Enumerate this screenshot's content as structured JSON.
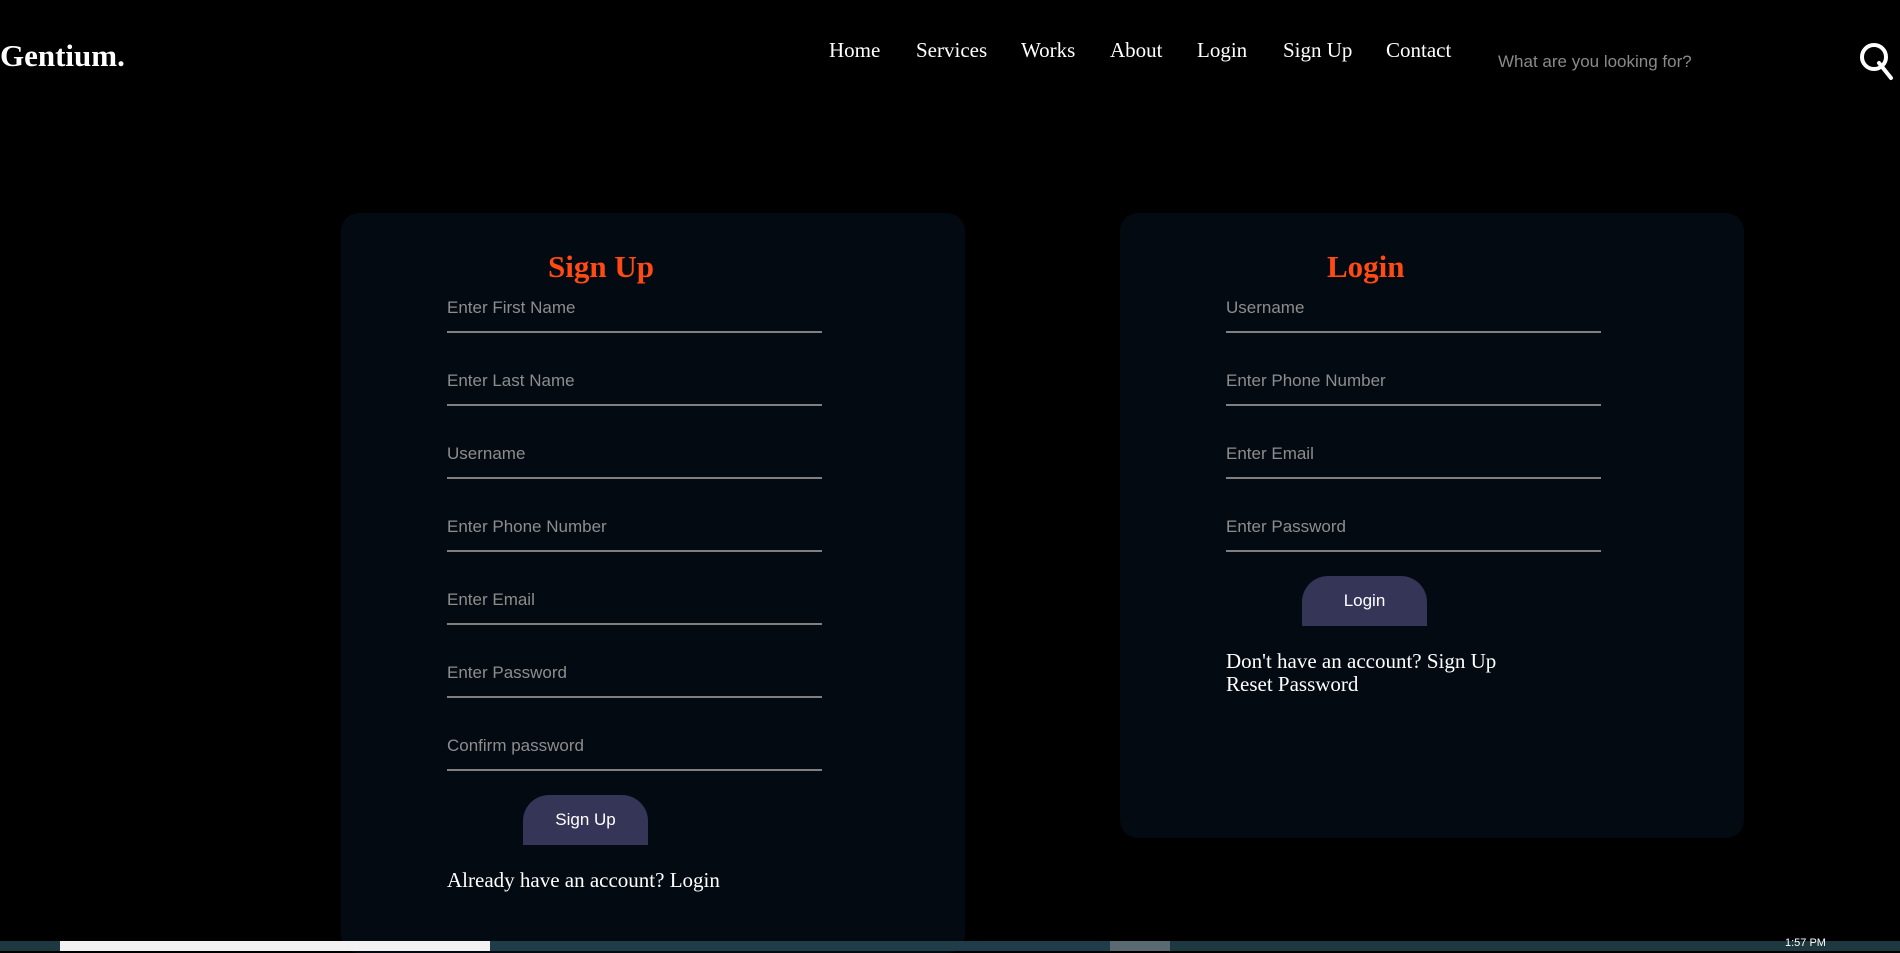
{
  "site": {
    "logo": "Gentium."
  },
  "nav": {
    "items": [
      {
        "id": "home",
        "label": "Home"
      },
      {
        "id": "services",
        "label": "Services"
      },
      {
        "id": "works",
        "label": "Works"
      },
      {
        "id": "about",
        "label": "About"
      },
      {
        "id": "login",
        "label": "Login"
      },
      {
        "id": "signup",
        "label": "Sign Up"
      },
      {
        "id": "contact",
        "label": "Contact"
      }
    ]
  },
  "search": {
    "placeholder": "What are you looking for?",
    "icon": "search-icon"
  },
  "signup_form": {
    "title": "Sign Up",
    "fields": {
      "first_name": "Enter First Name",
      "last_name": "Enter Last Name",
      "username": "Username",
      "phone": "Enter Phone Number",
      "email": "Enter Email",
      "password": "Enter Password",
      "confirm_password": "Confirm password"
    },
    "button_label": "Sign Up",
    "footer": "Already have an account? Login"
  },
  "login_form": {
    "title": "Login",
    "fields": {
      "username": "Username",
      "phone": "Enter Phone Number",
      "email": "Enter Email",
      "password": "Enter Password"
    },
    "button_label": "Login",
    "footer_signup": "Don't have an account? Sign Up",
    "footer_reset": "Reset Password"
  },
  "taskbar": {
    "clock": "1:57 PM"
  },
  "colors": {
    "background": "#000000",
    "card": "#030a12",
    "accent_title": "#ff4a14",
    "button": "#353558"
  }
}
